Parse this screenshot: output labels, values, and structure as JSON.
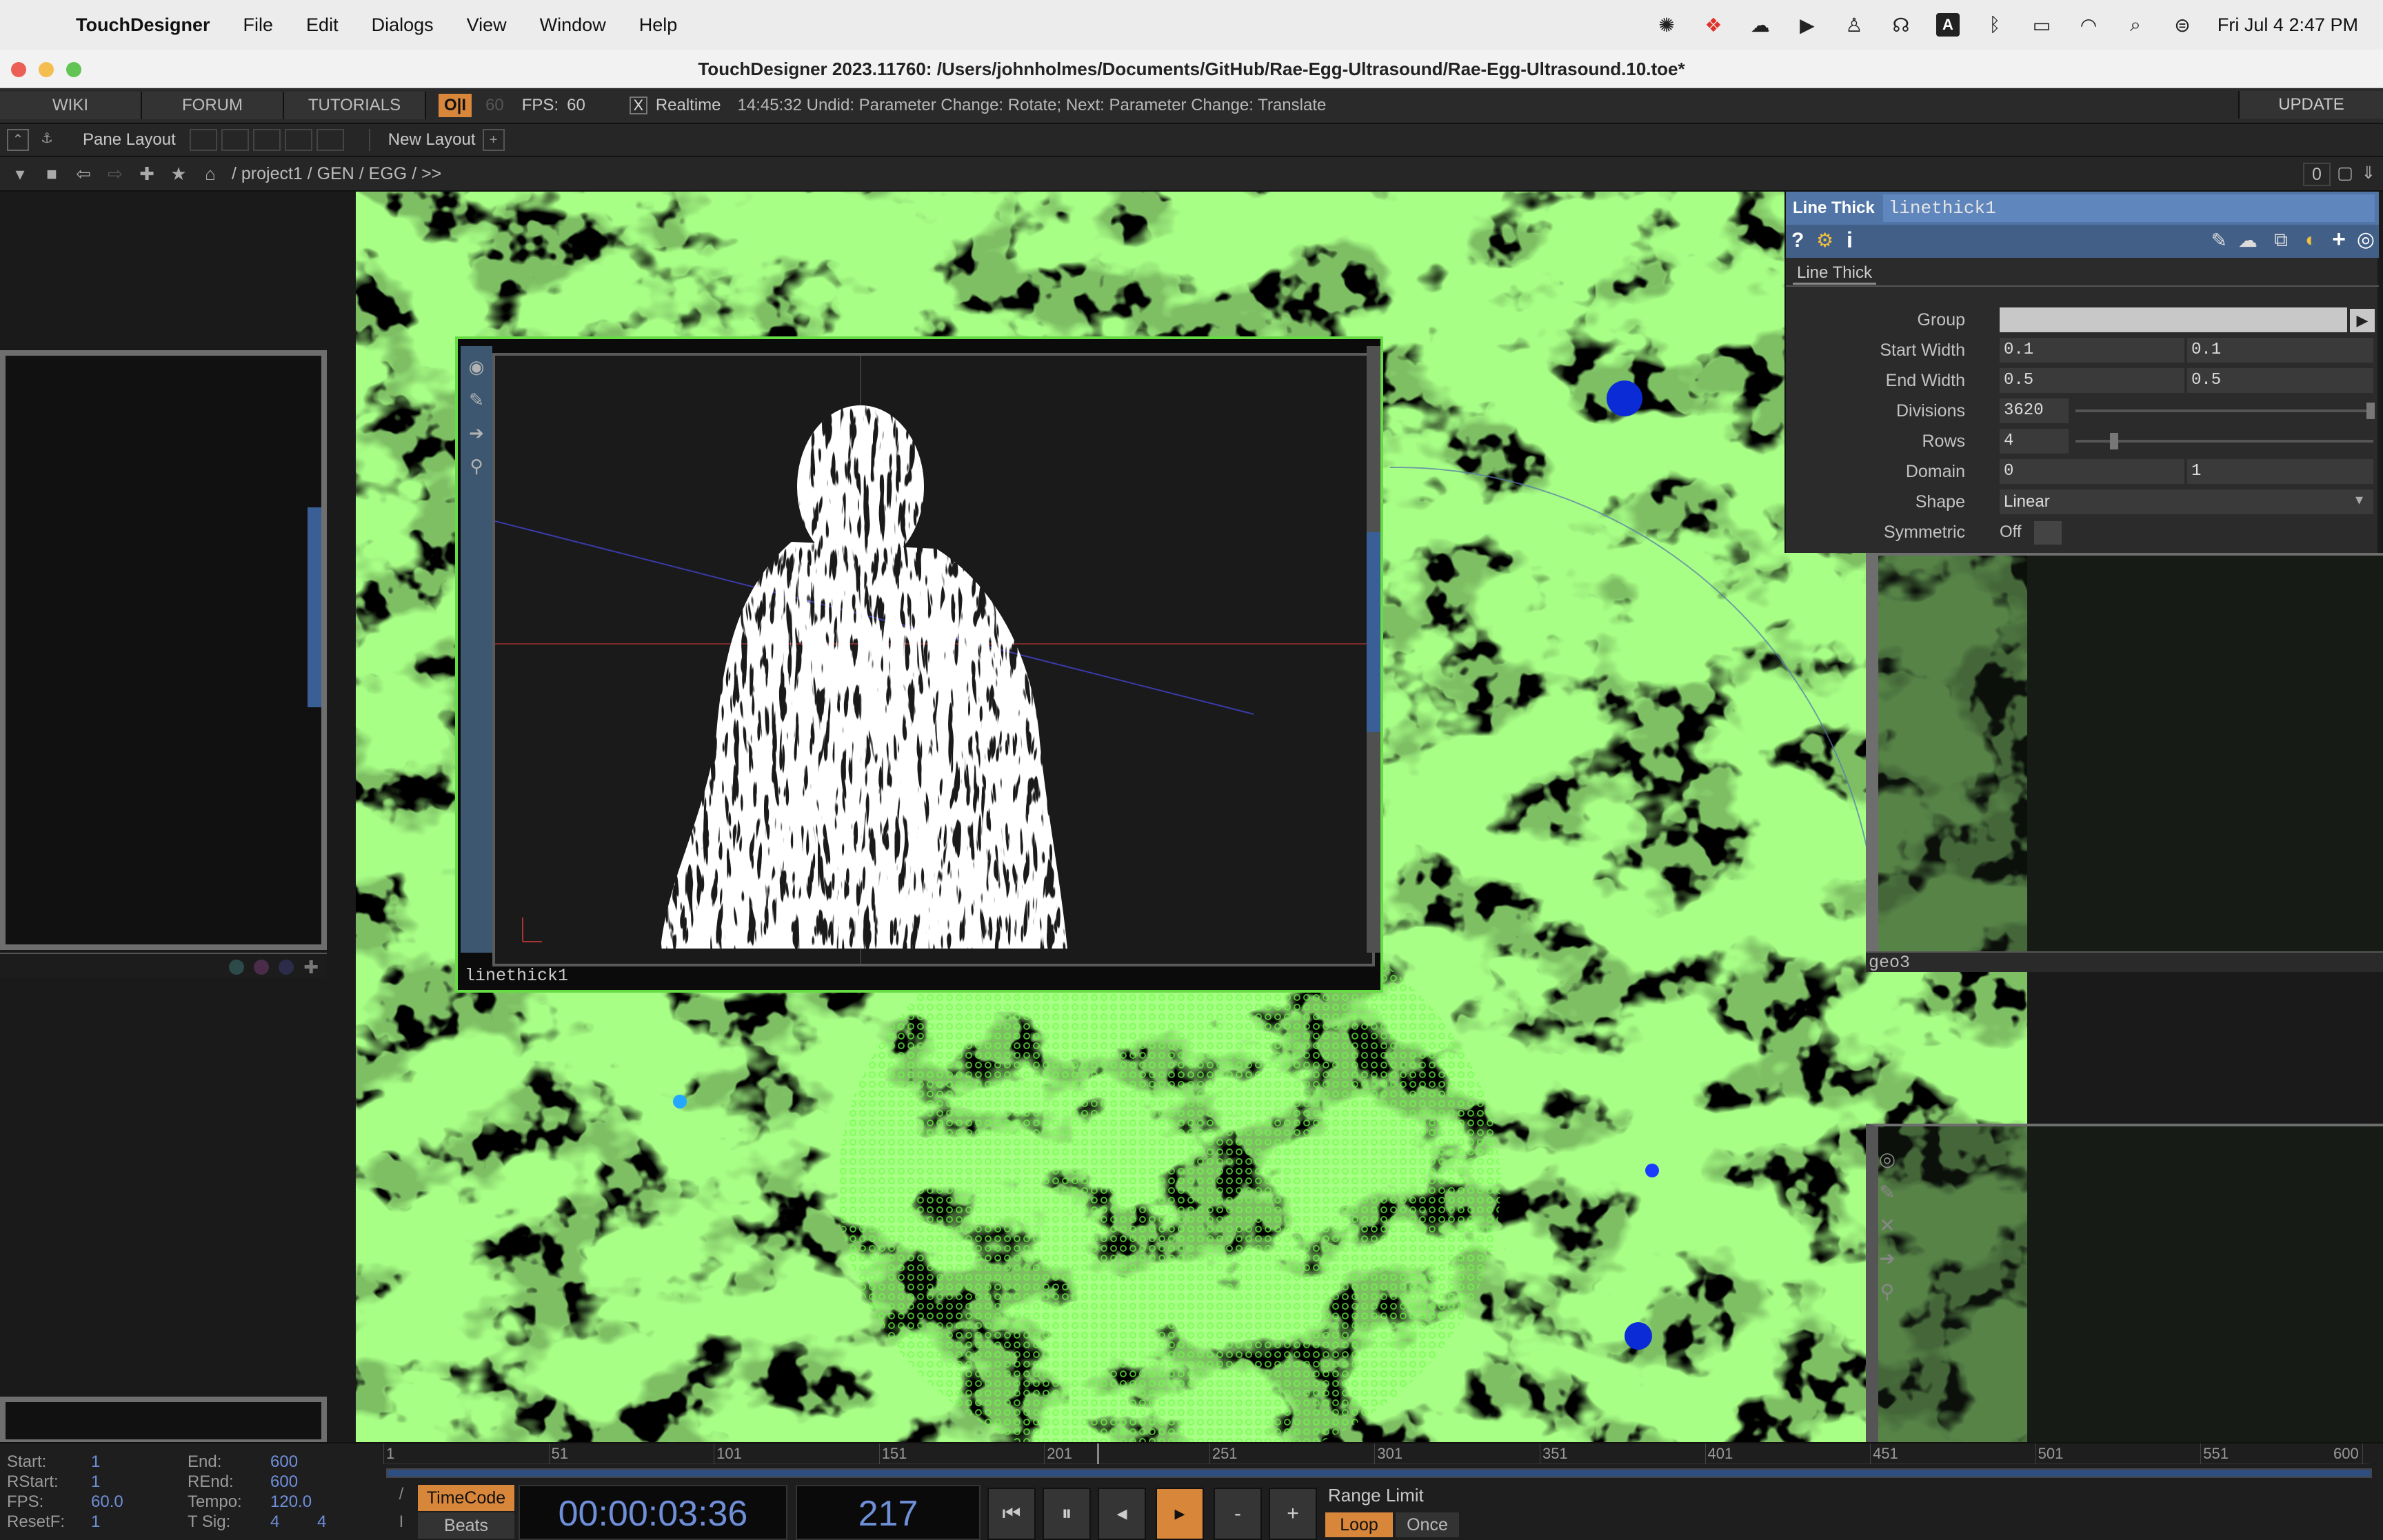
{
  "menubar": {
    "app_name": "TouchDesigner",
    "items": [
      "File",
      "Edit",
      "Dialogs",
      "View",
      "Window",
      "Help"
    ],
    "tray_a": "A",
    "clock": "Fri Jul 4  2:47 PM"
  },
  "window": {
    "title": "TouchDesigner 2023.11760: /Users/johnholmes/Documents/GitHub/Rae-Egg-Ultrasound/Rae-Egg-Ultrasound.10.toe*"
  },
  "toolbar": {
    "wiki": "WIKI",
    "forum": "FORUM",
    "tutorials": "TUTORIALS",
    "oi_label": "O|I",
    "fps_cap": "60",
    "fps_label": "FPS:",
    "fps_value": "60",
    "realtime_check": "X",
    "realtime_label": "Realtime",
    "status": "14:45:32 Undid: Parameter Change: Rotate; Next: Parameter Change: Translate",
    "update": "UPDATE"
  },
  "panebar": {
    "pane_layout": "Pane Layout",
    "new_layout": "New Layout",
    "add": "+"
  },
  "pathbar": {
    "path": "/ project1 / GEN / EGG / >>",
    "count": "0"
  },
  "viewer": {
    "label": "linethick1"
  },
  "geo_label": "geo3",
  "params": {
    "op_type": "Line Thick",
    "op_name": "linethick1",
    "tab": "Line Thick",
    "rows": [
      {
        "label": "Group",
        "v1": "",
        "v2": ""
      },
      {
        "label": "Start Width",
        "v1": "0.1",
        "v2": "0.1"
      },
      {
        "label": "End Width",
        "v1": "0.5",
        "v2": "0.5"
      },
      {
        "label": "Divisions",
        "v1": "3620",
        "v2": ""
      },
      {
        "label": "Rows",
        "v1": "4",
        "v2": ""
      },
      {
        "label": "Domain",
        "v1": "0",
        "v2": "1"
      },
      {
        "label": "Shape",
        "v1": "Linear",
        "v2": ""
      },
      {
        "label": "Symmetric",
        "v1": "Off",
        "v2": ""
      }
    ]
  },
  "timeline": {
    "start_label": "Start:",
    "start": "1",
    "end_label": "End:",
    "end": "600",
    "rstart_label": "RStart:",
    "rstart": "1",
    "rend_label": "REnd:",
    "rend": "600",
    "fps_label": "FPS:",
    "fps": "60.0",
    "tempo_label": "Tempo:",
    "tempo": "120.0",
    "resetf_label": "ResetF:",
    "resetf": "1",
    "tsig_label": "T Sig:",
    "tsig_a": "4",
    "tsig_b": "4",
    "ticks": [
      "1",
      "51",
      "101",
      "151",
      "201",
      "251",
      "301",
      "351",
      "401",
      "451",
      "501",
      "551",
      "600"
    ],
    "timecode_btn": "TimeCode",
    "beats_btn": "Beats",
    "timecode": "00:00:03:36",
    "frame": "217",
    "range_limit": "Range Limit",
    "loop": "Loop",
    "once": "Once",
    "minus": "-",
    "plus": "+",
    "playhead_frame": 217
  },
  "colors": {
    "accent_orange": "#d8863a",
    "param_header": "#5075a6",
    "viewer_border": "#66dd44",
    "timecode_text": "#6f8fd8"
  }
}
